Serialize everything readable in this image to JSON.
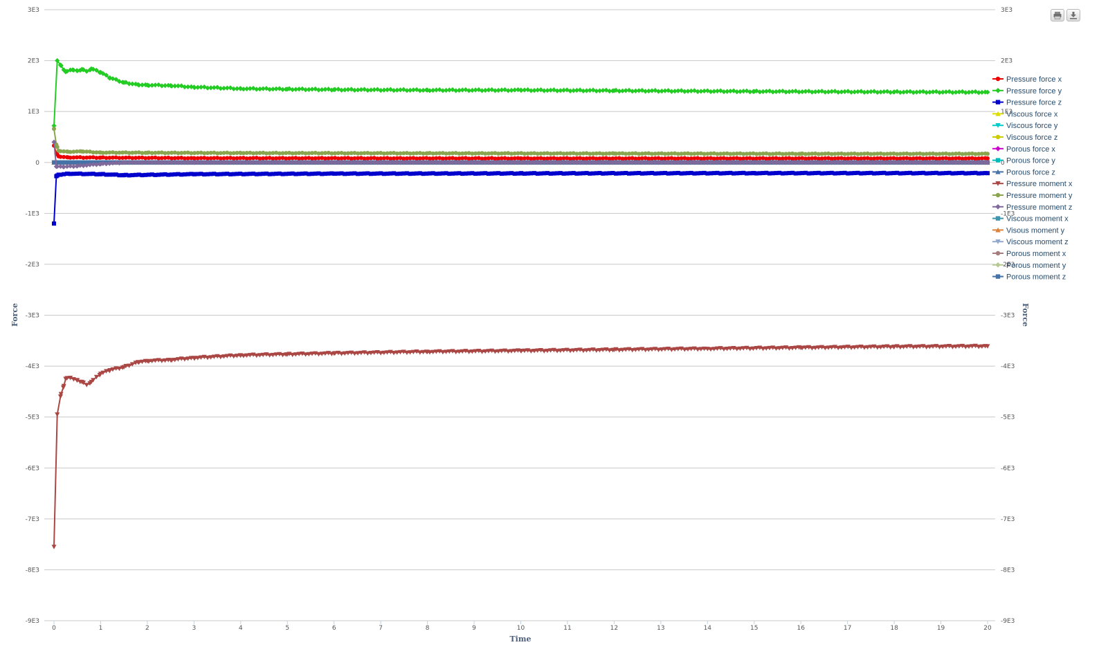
{
  "toolbar": {
    "print_icon": "print-icon",
    "download_icon": "download-icon"
  },
  "chart_data": {
    "type": "line",
    "xlabel": "Time",
    "ylabel": "Force",
    "ylabel_right": "Force",
    "xlim": [
      0,
      20
    ],
    "ylim": [
      -9000,
      3000
    ],
    "x_ticks": [
      "0",
      "1",
      "2",
      "3",
      "4",
      "5",
      "6",
      "7",
      "8",
      "9",
      "10",
      "11",
      "12",
      "13",
      "14",
      "15",
      "16",
      "17",
      "18",
      "19",
      "20"
    ],
    "y_ticks": [
      {
        "v": 3000,
        "label": "3E3"
      },
      {
        "v": 2000,
        "label": "2E3"
      },
      {
        "v": 1000,
        "label": "1E3"
      },
      {
        "v": 0,
        "label": "0"
      },
      {
        "v": -1000,
        "label": "-1E3"
      },
      {
        "v": -2000,
        "label": "-2E3"
      },
      {
        "v": -3000,
        "label": "-3E3"
      },
      {
        "v": -4000,
        "label": "-4E3"
      },
      {
        "v": -5000,
        "label": "-5E3"
      },
      {
        "v": -6000,
        "label": "-6E3"
      },
      {
        "v": -7000,
        "label": "-7E3"
      },
      {
        "v": -8000,
        "label": "-8E3"
      },
      {
        "v": -9000,
        "label": "-9E3"
      }
    ],
    "grid": true,
    "legend_position": "right",
    "series": [
      {
        "name": "Pressure force x",
        "color": "#ee0000",
        "marker": "circle",
        "points": [
          [
            0,
            330
          ],
          [
            0.05,
            180
          ],
          [
            0.1,
            120
          ],
          [
            0.3,
            100
          ],
          [
            1,
            95
          ],
          [
            3,
            85
          ],
          [
            10,
            80
          ],
          [
            20,
            80
          ]
        ]
      },
      {
        "name": "Pressure force y",
        "color": "#22cc22",
        "marker": "diamond",
        "points": [
          [
            0,
            720
          ],
          [
            0.07,
            2000
          ],
          [
            0.15,
            1900
          ],
          [
            0.25,
            1780
          ],
          [
            0.4,
            1820
          ],
          [
            0.5,
            1800
          ],
          [
            0.6,
            1830
          ],
          [
            0.7,
            1790
          ],
          [
            0.8,
            1840
          ],
          [
            1,
            1770
          ],
          [
            1.2,
            1660
          ],
          [
            1.5,
            1570
          ],
          [
            1.8,
            1530
          ],
          [
            2,
            1520
          ],
          [
            2.5,
            1510
          ],
          [
            3,
            1480
          ],
          [
            4,
            1450
          ],
          [
            5,
            1440
          ],
          [
            6,
            1430
          ],
          [
            8,
            1420
          ],
          [
            10,
            1420
          ],
          [
            12,
            1410
          ],
          [
            15,
            1395
          ],
          [
            18,
            1385
          ],
          [
            20,
            1380
          ]
        ]
      },
      {
        "name": "Pressure force z",
        "color": "#0000cc",
        "marker": "square",
        "points": [
          [
            0,
            -1200
          ],
          [
            0.05,
            -270
          ],
          [
            0.1,
            -240
          ],
          [
            0.3,
            -220
          ],
          [
            1,
            -230
          ],
          [
            1.5,
            -250
          ],
          [
            3,
            -230
          ],
          [
            6,
            -220
          ],
          [
            10,
            -215
          ],
          [
            15,
            -210
          ],
          [
            20,
            -210
          ]
        ]
      },
      {
        "name": "Viscous force x",
        "color": "#dddd00",
        "marker": "triangle",
        "points": [
          [
            0,
            0
          ],
          [
            20,
            0
          ]
        ]
      },
      {
        "name": "Viscous force y",
        "color": "#00cccc",
        "marker": "triangle-down",
        "points": [
          [
            0,
            0
          ],
          [
            20,
            0
          ]
        ]
      },
      {
        "name": "Viscous force z",
        "color": "#cccc00",
        "marker": "circle",
        "points": [
          [
            0,
            0
          ],
          [
            20,
            0
          ]
        ]
      },
      {
        "name": "Porous force x",
        "color": "#cc00cc",
        "marker": "diamond",
        "points": [
          [
            0,
            0
          ],
          [
            20,
            0
          ]
        ]
      },
      {
        "name": "Porous force y",
        "color": "#00bbbb",
        "marker": "square",
        "points": [
          [
            0,
            0
          ],
          [
            20,
            0
          ]
        ]
      },
      {
        "name": "Porous force z",
        "color": "#4572a7",
        "marker": "triangle",
        "points": [
          [
            0,
            0
          ],
          [
            20,
            0
          ]
        ]
      },
      {
        "name": "Pressure moment x",
        "color": "#aa4643",
        "marker": "triangle-down",
        "points": [
          [
            0,
            -7550
          ],
          [
            0.07,
            -4950
          ],
          [
            0.15,
            -4550
          ],
          [
            0.2,
            -4420
          ],
          [
            0.25,
            -4250
          ],
          [
            0.35,
            -4230
          ],
          [
            0.5,
            -4280
          ],
          [
            0.6,
            -4310
          ],
          [
            0.7,
            -4370
          ],
          [
            0.8,
            -4310
          ],
          [
            1,
            -4150
          ],
          [
            1.2,
            -4080
          ],
          [
            1.5,
            -4020
          ],
          [
            1.8,
            -3920
          ],
          [
            2,
            -3900
          ],
          [
            2.5,
            -3880
          ],
          [
            3,
            -3840
          ],
          [
            4,
            -3790
          ],
          [
            5,
            -3770
          ],
          [
            6,
            -3750
          ],
          [
            8,
            -3720
          ],
          [
            10,
            -3700
          ],
          [
            12,
            -3680
          ],
          [
            14,
            -3660
          ],
          [
            16,
            -3640
          ],
          [
            18,
            -3620
          ],
          [
            20,
            -3610
          ]
        ]
      },
      {
        "name": "Pressure moment y",
        "color": "#89a54e",
        "marker": "circle",
        "points": [
          [
            0,
            660
          ],
          [
            0.05,
            350
          ],
          [
            0.1,
            230
          ],
          [
            0.3,
            210
          ],
          [
            0.6,
            215
          ],
          [
            1,
            195
          ],
          [
            2,
            190
          ],
          [
            4,
            185
          ],
          [
            8,
            180
          ],
          [
            12,
            175
          ],
          [
            16,
            170
          ],
          [
            20,
            170
          ]
        ]
      },
      {
        "name": "Pressure moment z",
        "color": "#80699b",
        "marker": "diamond",
        "points": [
          [
            0,
            400
          ],
          [
            0.05,
            -80
          ],
          [
            0.2,
            -85
          ],
          [
            0.5,
            -70
          ],
          [
            1,
            -30
          ],
          [
            1.5,
            0
          ],
          [
            3,
            0
          ],
          [
            20,
            0
          ]
        ]
      },
      {
        "name": "Viscous moment x",
        "color": "#3d96ae",
        "marker": "square",
        "points": [
          [
            0,
            0
          ],
          [
            20,
            0
          ]
        ]
      },
      {
        "name": "Visous moment y",
        "color": "#db843d",
        "marker": "triangle",
        "points": [
          [
            0,
            0
          ],
          [
            20,
            0
          ]
        ]
      },
      {
        "name": "Viscous moment z",
        "color": "#92a8cd",
        "marker": "triangle-down",
        "points": [
          [
            0,
            0
          ],
          [
            20,
            0
          ]
        ]
      },
      {
        "name": "Porous moment x",
        "color": "#a47d7c",
        "marker": "circle",
        "points": [
          [
            0,
            0
          ],
          [
            20,
            0
          ]
        ]
      },
      {
        "name": "Porous moment y",
        "color": "#b5ca92",
        "marker": "diamond",
        "points": [
          [
            0,
            0
          ],
          [
            20,
            0
          ]
        ]
      },
      {
        "name": "Porous moment z",
        "color": "#4572a7",
        "marker": "square",
        "points": [
          [
            0,
            0
          ],
          [
            20,
            0
          ]
        ]
      }
    ]
  }
}
